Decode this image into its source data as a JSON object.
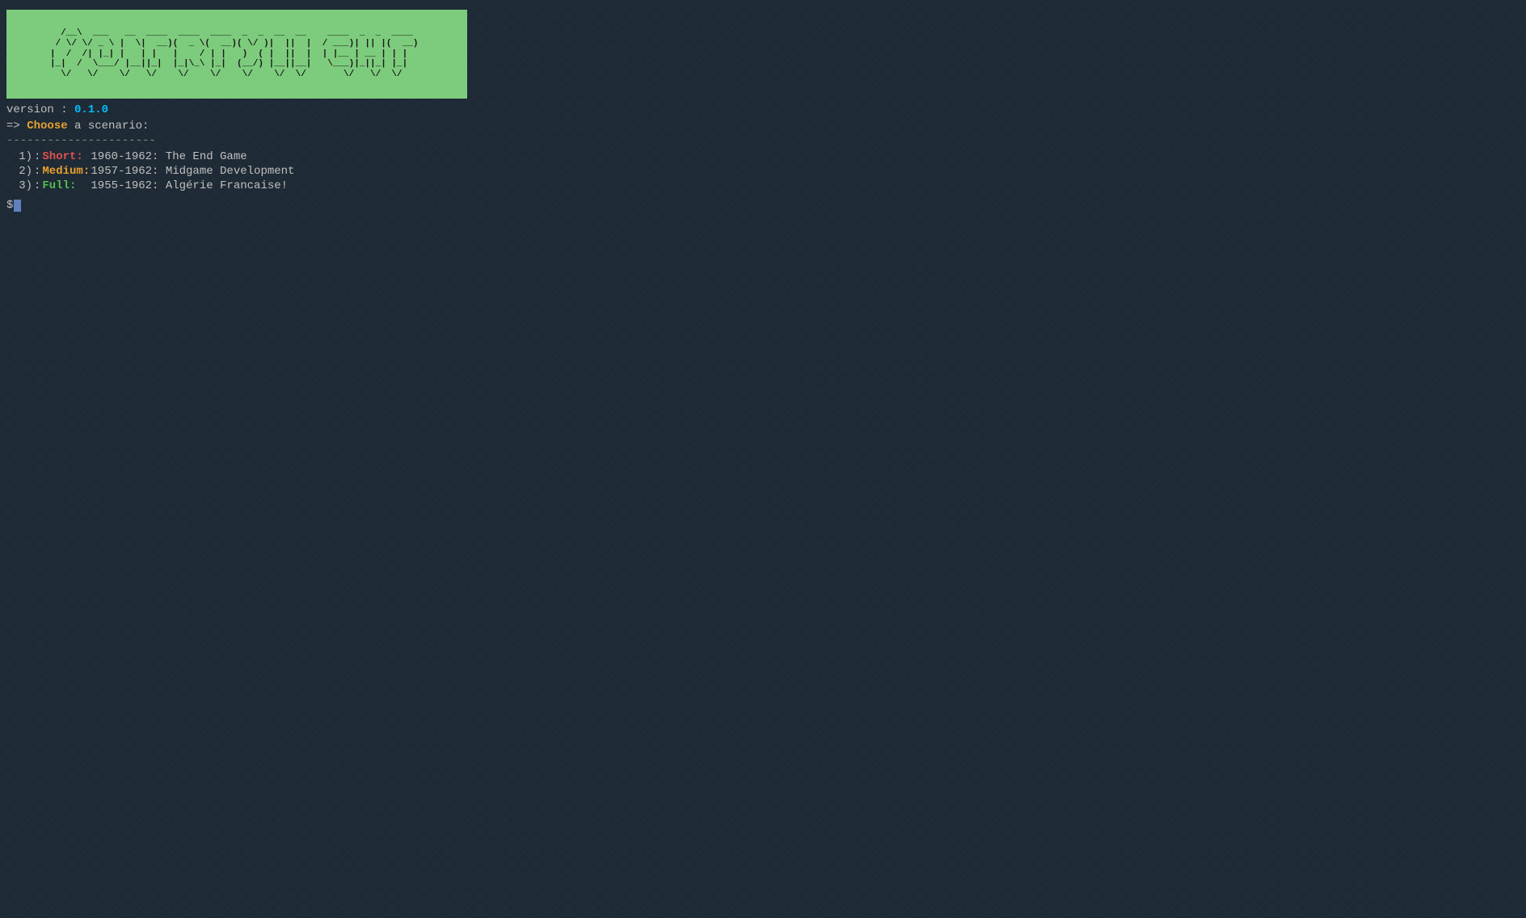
{
  "banner": {
    "ascii_art": "  /__\\  ___  _  _  ____  ____  ____  ____  ____\n / \\/ \\/ _ \\| \\/ || ___)/ ___)(  __)(  _ \\(_  _)\n|  /  /| |_||      || |  | |___ | |   |    /  | |\n|_|  /  \\___/|_|\\_||_|  \\____/ |_|  |_|\\_\\  |_|\n  \\/   \\/ \\/   \\/ \\/    \\/    \\/ \\/   \\/     \\/"
  },
  "version": {
    "label": "version : ",
    "number": "0.1.0"
  },
  "prompt": {
    "arrow": "=>",
    "choose_text": "Choose",
    "rest_text": " a scenario:"
  },
  "separator": "----------------------",
  "scenarios": [
    {
      "number": "1)",
      "colon": ":",
      "type": "Short:",
      "type_class": "short",
      "description": "  1960-1962: The End Game"
    },
    {
      "number": "2)",
      "colon": ":",
      "type": "Medium:",
      "type_class": "medium",
      "description": " 1957-1962: Midgame Development"
    },
    {
      "number": "3)",
      "colon": ":",
      "type": "Full:",
      "type_class": "full",
      "description": "   1955-1962: Algérie Francaise!"
    }
  ],
  "command_prompt": {
    "dollar": "$"
  }
}
